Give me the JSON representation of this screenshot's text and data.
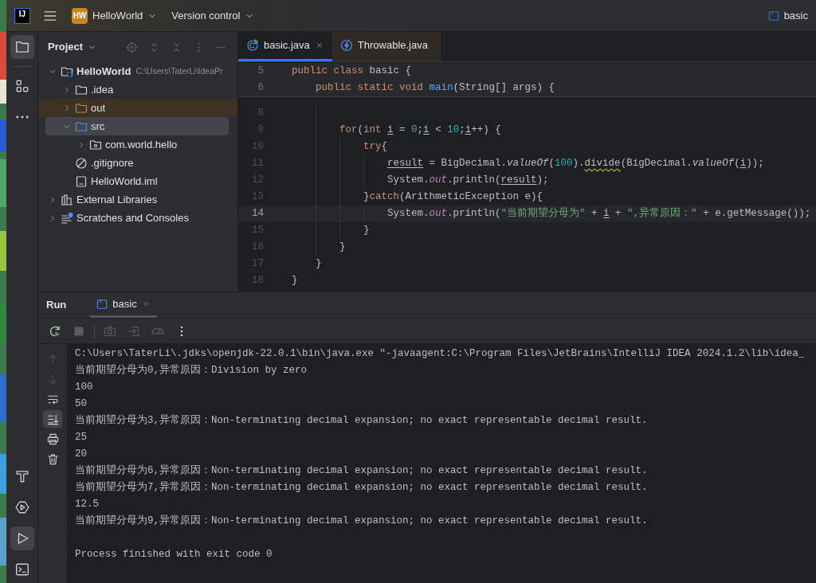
{
  "title_bar": {
    "logo": "IJ",
    "project_badge": "HW",
    "project": "HelloWorld",
    "vcs": "Version control",
    "run_config": "basic"
  },
  "tool_stripe": {
    "top": [
      {
        "kind": "project",
        "selected": true
      },
      {
        "kind": "structure",
        "selected": false
      },
      {
        "kind": "more",
        "selected": false
      }
    ],
    "bottom": [
      {
        "kind": "build",
        "selected": false
      },
      {
        "kind": "services",
        "selected": false
      },
      {
        "kind": "run",
        "selected": true
      },
      {
        "kind": "terminal",
        "selected": false
      }
    ]
  },
  "project_panel": {
    "title": "Project",
    "tree": [
      {
        "kind": "module",
        "label": "HelloWorld",
        "path": "C:\\Users\\TaterLi\\IdeaPr",
        "expanded": true,
        "selected": false,
        "children": [
          {
            "kind": "folder",
            "label": ".idea",
            "expanded": false,
            "selected": false
          },
          {
            "kind": "excluded",
            "label": "out",
            "expanded": false,
            "selected": false
          },
          {
            "kind": "source",
            "label": "src",
            "expanded": true,
            "selected": true,
            "children": [
              {
                "kind": "package",
                "label": "com.world.hello",
                "expanded": false,
                "selected": false
              }
            ]
          },
          {
            "kind": "ignore",
            "label": ".gitignore",
            "selected": false
          },
          {
            "kind": "iml",
            "label": "HelloWorld.iml",
            "selected": false
          }
        ]
      },
      {
        "kind": "libraries",
        "label": "External Libraries",
        "expanded": false,
        "selected": false
      },
      {
        "kind": "scratches",
        "label": "Scratches and Consoles",
        "expanded": false,
        "selected": false
      }
    ]
  },
  "editor": {
    "tabs": [
      {
        "kind": "class",
        "label": "basic.java",
        "selected": true
      },
      {
        "kind": "exception",
        "label": "Throwable.java",
        "selected": false
      }
    ],
    "code": [
      {
        "number": "5",
        "sticky": true,
        "current": false,
        "segments": [
          {
            "kind": "kw",
            "text": "public class"
          },
          {
            "kind": "plain",
            "text": " basic {"
          }
        ],
        "children": [
          {
            "number": "6",
            "sticky": true,
            "current": false,
            "segments": [
              {
                "kind": "kw",
                "text": "public static void "
              },
              {
                "kind": "method",
                "text": "main"
              },
              {
                "kind": "plain",
                "text": "(String[] args) {"
              }
            ],
            "children": [
              {
                "number": "8",
                "sticky": false,
                "current": false
              },
              {
                "number": "9",
                "sticky": false,
                "current": false,
                "segments": [
                  {
                    "kind": "kw",
                    "text": "for"
                  },
                  {
                    "kind": "plain",
                    "text": "("
                  },
                  {
                    "kind": "kw",
                    "text": "int "
                  },
                  {
                    "kind": "var",
                    "text": "i"
                  },
                  {
                    "kind": "plain",
                    "text": " = "
                  },
                  {
                    "kind": "num",
                    "text": "0"
                  },
                  {
                    "kind": "plain",
                    "text": ";"
                  },
                  {
                    "kind": "var",
                    "text": "i"
                  },
                  {
                    "kind": "plain",
                    "text": " < "
                  },
                  {
                    "kind": "num",
                    "text": "10"
                  },
                  {
                    "kind": "plain",
                    "text": ";"
                  },
                  {
                    "kind": "var",
                    "text": "i"
                  },
                  {
                    "kind": "plain",
                    "text": "++) {"
                  }
                ],
                "children": [
                  {
                    "number": "10",
                    "sticky": false,
                    "current": false,
                    "segments": [
                      {
                        "kind": "kw",
                        "text": "try"
                      },
                      {
                        "kind": "plain",
                        "text": "{"
                      }
                    ],
                    "children": [
                      {
                        "number": "11",
                        "sticky": false,
                        "current": false,
                        "segments": [
                          {
                            "kind": "var",
                            "text": "result"
                          },
                          {
                            "kind": "plain",
                            "text": " = BigDecimal."
                          },
                          {
                            "kind": "static",
                            "text": "valueOf"
                          },
                          {
                            "kind": "plain",
                            "text": "("
                          },
                          {
                            "kind": "num",
                            "text": "100"
                          },
                          {
                            "kind": "plain",
                            "text": ")."
                          },
                          {
                            "kind": "warn",
                            "text": "divide"
                          },
                          {
                            "kind": "plain",
                            "text": "(BigDecimal."
                          },
                          {
                            "kind": "static",
                            "text": "valueOf"
                          },
                          {
                            "kind": "plain",
                            "text": "("
                          },
                          {
                            "kind": "var",
                            "text": "i"
                          },
                          {
                            "kind": "plain",
                            "text": "));"
                          }
                        ]
                      },
                      {
                        "number": "12",
                        "sticky": false,
                        "current": false,
                        "segments": [
                          {
                            "kind": "plain",
                            "text": "System."
                          },
                          {
                            "kind": "field",
                            "text": "out"
                          },
                          {
                            "kind": "plain",
                            "text": ".println("
                          },
                          {
                            "kind": "var",
                            "text": "result"
                          },
                          {
                            "kind": "plain",
                            "text": ");"
                          }
                        ]
                      }
                    ]
                  },
                  {
                    "number": "13",
                    "sticky": false,
                    "current": false,
                    "segments": [
                      {
                        "kind": "plain",
                        "text": "}"
                      },
                      {
                        "kind": "kw",
                        "text": "catch"
                      },
                      {
                        "kind": "plain",
                        "text": "(ArithmeticException e){"
                      }
                    ],
                    "children": [
                      {
                        "number": "14",
                        "sticky": false,
                        "current": true,
                        "segments": [
                          {
                            "kind": "plain",
                            "text": "System."
                          },
                          {
                            "kind": "field",
                            "text": "out"
                          },
                          {
                            "kind": "plain",
                            "text": ".println("
                          },
                          {
                            "kind": "str",
                            "text": "\"当前期望分母为\""
                          },
                          {
                            "kind": "plain",
                            "text": " + "
                          },
                          {
                            "kind": "var",
                            "text": "i"
                          },
                          {
                            "kind": "plain",
                            "text": " + "
                          },
                          {
                            "kind": "str",
                            "text": "\",异常原因：\""
                          },
                          {
                            "kind": "plain",
                            "text": " + e.getMessage());"
                          }
                        ]
                      }
                    ]
                  },
                  {
                    "number": "15",
                    "sticky": false,
                    "current": false,
                    "segments": [
                      {
                        "kind": "plain",
                        "text": "}"
                      }
                    ]
                  }
                ]
              },
              {
                "number": "16",
                "sticky": false,
                "current": false,
                "segments": [
                  {
                    "kind": "plain",
                    "text": "}"
                  }
                ]
              }
            ]
          },
          {
            "number": "17",
            "sticky": false,
            "current": false,
            "segments": [
              {
                "kind": "plain",
                "text": "}"
              }
            ]
          }
        ]
      },
      {
        "number": "18",
        "sticky": false,
        "current": false,
        "segments": [
          {
            "kind": "plain",
            "text": "}"
          }
        ]
      }
    ]
  },
  "run_panel": {
    "title": "Run",
    "tabs": [
      {
        "label": "basic",
        "selected": true
      }
    ],
    "toolbar": [
      {
        "kind": "rerun",
        "disabled": false
      },
      {
        "kind": "stop",
        "disabled": true
      },
      {
        "kind": "separator"
      },
      {
        "kind": "camera",
        "disabled": true
      },
      {
        "kind": "exit",
        "disabled": true
      },
      {
        "kind": "gauge",
        "disabled": true
      },
      {
        "kind": "more",
        "disabled": false
      }
    ],
    "gutter": [
      {
        "kind": "up",
        "disabled": true,
        "selected": false
      },
      {
        "kind": "down",
        "disabled": true,
        "selected": false
      },
      {
        "kind": "wrap",
        "disabled": false,
        "selected": false
      },
      {
        "kind": "scroll-end",
        "disabled": false,
        "selected": true
      },
      {
        "kind": "print",
        "disabled": false,
        "selected": false
      },
      {
        "kind": "trash",
        "disabled": false,
        "selected": false
      }
    ],
    "output": [
      {
        "kind": "text",
        "text": "C:\\Users\\TaterLi\\.jdks\\openjdk-22.0.1\\bin\\java.exe \"-javaagent:C:\\Program Files\\JetBrains\\IntelliJ IDEA 2024.1.2\\lib\\idea_"
      },
      {
        "kind": "text",
        "text": "当前期望分母为0,异常原因：Division by zero"
      },
      {
        "kind": "text",
        "text": "100"
      },
      {
        "kind": "text",
        "text": "50"
      },
      {
        "kind": "text",
        "text": "当前期望分母为3,异常原因：Non-terminating decimal expansion; no exact representable decimal result."
      },
      {
        "kind": "text",
        "text": "25"
      },
      {
        "kind": "text",
        "text": "20"
      },
      {
        "kind": "text",
        "text": "当前期望分母为6,异常原因：Non-terminating decimal expansion; no exact representable decimal result."
      },
      {
        "kind": "text",
        "text": "当前期望分母为7,异常原因：Non-terminating decimal expansion; no exact representable decimal result."
      },
      {
        "kind": "text",
        "text": "12.5"
      },
      {
        "kind": "text",
        "text": "当前期望分母为9,异常原因：Non-terminating decimal expansion; no exact representable decimal result."
      },
      {
        "kind": "blank"
      },
      {
        "kind": "text",
        "text": "Process finished with exit code 0"
      }
    ]
  }
}
